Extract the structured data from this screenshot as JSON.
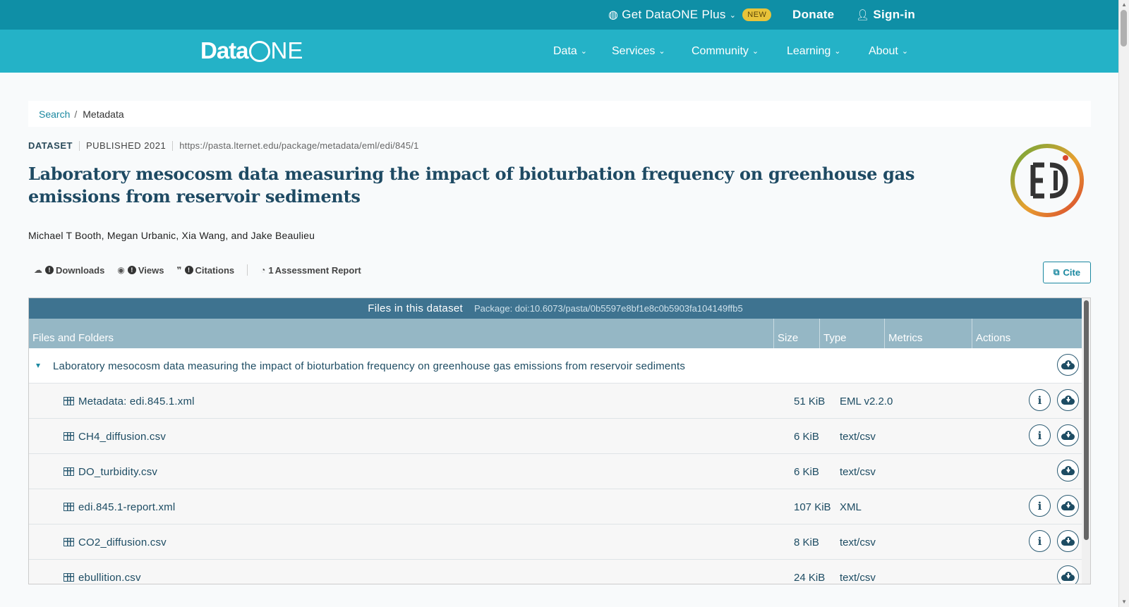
{
  "topbar": {
    "plus_label": "Get DataONE Plus",
    "new_badge": "NEW",
    "donate": "Donate",
    "signin": "Sign-in"
  },
  "nav": {
    "logo": {
      "data": "Data",
      "one": "NE"
    },
    "items": [
      "Data",
      "Services",
      "Community",
      "Learning",
      "About"
    ]
  },
  "breadcrumb": {
    "search": "Search",
    "sep": "/",
    "current": "Metadata"
  },
  "dataset": {
    "type_label": "DATASET",
    "published": "PUBLISHED 2021",
    "url": "https://pasta.lternet.edu/package/metadata/eml/edi/845/1",
    "title": "Laboratory mesocosm data measuring the impact of bioturbation frequency on greenhouse gas emissions from reservoir sediments",
    "authors": "Michael T Booth, Megan Urbanic, Xia Wang, and Jake Beaulieu"
  },
  "metrics": {
    "downloads": "Downloads",
    "views": "Views",
    "citations": "Citations",
    "assessment_count": "1",
    "assessment_label": "Assessment Report",
    "cite": "Cite"
  },
  "files": {
    "heading": "Files in this dataset",
    "package": "Package: doi:10.6073/pasta/0b5597e8bf1e8c0b5903fa104149ffb5",
    "columns": [
      "Files and Folders",
      "Size",
      "Type",
      "Metrics",
      "Actions"
    ],
    "root": "Laboratory mesocosm data measuring the impact of bioturbation frequency on greenhouse gas emissions from reservoir sediments",
    "rows": [
      {
        "name": "Metadata: edi.845.1.xml",
        "size": "51 KiB",
        "type": "EML v2.2.0"
      },
      {
        "name": "CH4_diffusion.csv",
        "size": "6 KiB",
        "type": "text/csv"
      },
      {
        "name": "DO_turbidity.csv",
        "size": "6 KiB",
        "type": "text/csv"
      },
      {
        "name": "edi.845.1-report.xml",
        "size": "107 KiB",
        "type": "XML"
      },
      {
        "name": "CO2_diffusion.csv",
        "size": "8 KiB",
        "type": "text/csv"
      },
      {
        "name": "ebullition.csv",
        "size": "24 KiB",
        "type": "text/csv"
      }
    ]
  },
  "icons": {
    "info_glyph": "i",
    "caret": "▾",
    "info_available": [
      false,
      true,
      true,
      false,
      true,
      true
    ]
  }
}
